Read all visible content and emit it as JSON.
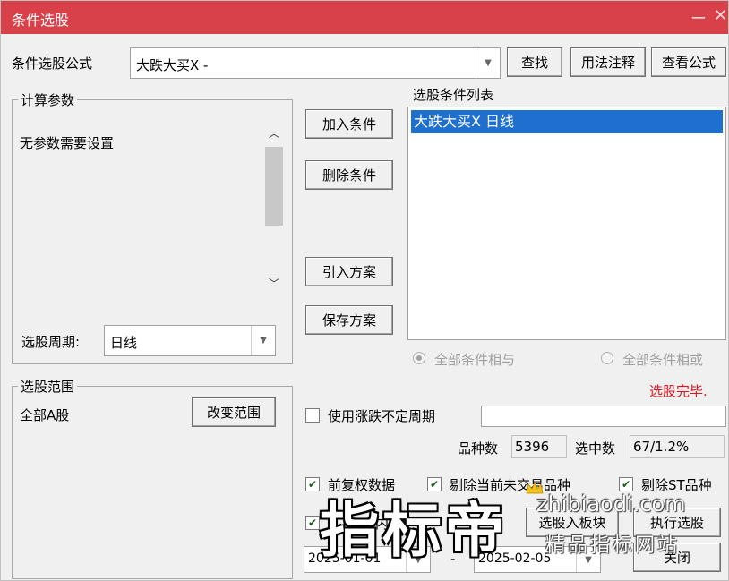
{
  "window": {
    "title": "条件选股",
    "minimize": "ー",
    "close": "✕"
  },
  "formula": {
    "label": "条件选股公式",
    "value": "大跌大买X  -",
    "find": "查找",
    "usage": "用法注释",
    "view": "查看公式"
  },
  "params": {
    "legend": "计算参数",
    "text": "无参数需要设置",
    "period_label": "选股周期:",
    "period_value": "日线"
  },
  "actions": {
    "add": "加入条件",
    "delete": "删除条件",
    "import": "引入方案",
    "save": "保存方案"
  },
  "conditions": {
    "label": "选股条件列表",
    "items": [
      "大跌大买X  日线"
    ],
    "and_label": "全部条件相与",
    "or_label": "全部条件相或"
  },
  "status": {
    "text": "选股完毕.",
    "color": "#e0141e"
  },
  "range": {
    "legend": "选股范围",
    "value": "全部A股",
    "change": "改变范围"
  },
  "options": {
    "variable_period": "使用涨跌不定周期",
    "count_label": "品种数",
    "count_value": "5396",
    "selected_label": "选中数",
    "selected_value": "67/1.2%",
    "prev_adjust": "前复权数据",
    "exclude_untraded": "剔除当前未交易品种",
    "exclude_st": "剔除ST品种",
    "time_range_partial": "内",
    "to_block": "选股入板块",
    "run": "执行选股",
    "close": "关闭",
    "date_start": "2025-01-01",
    "date_sep": "-",
    "date_end": "2025-02-05"
  },
  "watermark": {
    "main": "指标帝",
    "url": "zhibiaodi.com",
    "sub": "精品指标网站"
  }
}
